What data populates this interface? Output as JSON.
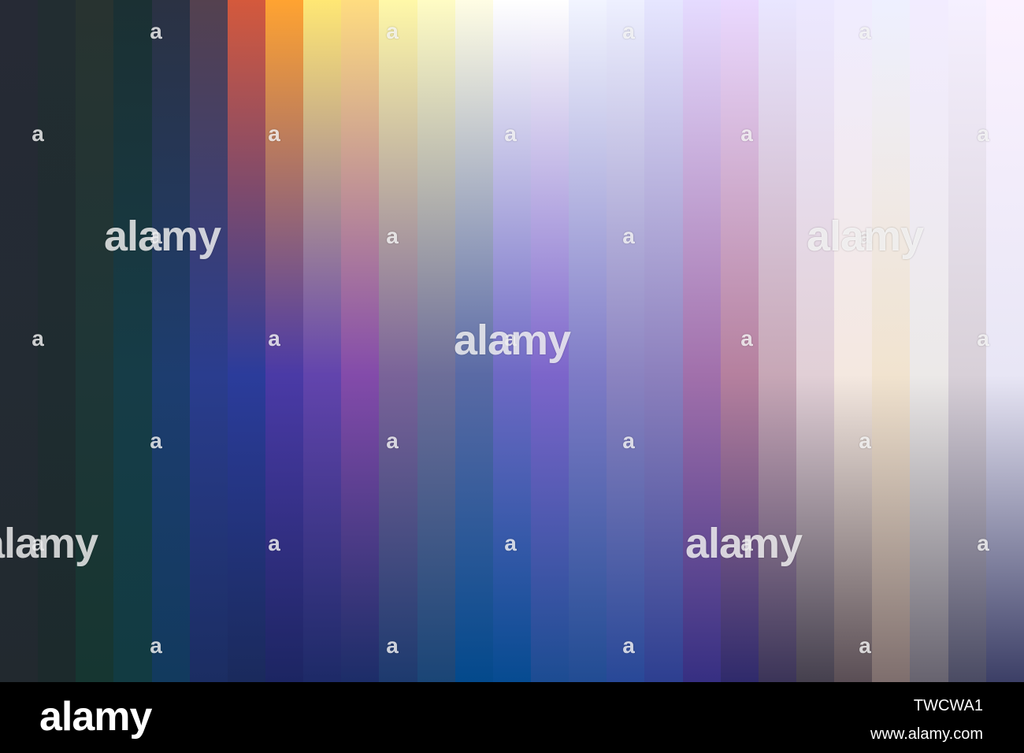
{
  "stripes": [
    [
      "#262a35",
      "#232b33",
      "#22292f"
    ],
    [
      "#222d31",
      "#1f2c30",
      "#1c2a2c"
    ],
    [
      "#283330",
      "#1e3637",
      "#163631"
    ],
    [
      "#1b3033",
      "#163c47",
      "#123b42"
    ],
    [
      "#2b3243",
      "#1d3d6f",
      "#123a5e"
    ],
    [
      "#54414f",
      "#2a3d8e",
      "#1b2d62"
    ],
    [
      "#d4593c",
      "#2b3c9b",
      "#1a2a5c"
    ],
    [
      "#ffa331",
      "#4a3aa6",
      "#1c2562"
    ],
    [
      "#ffe774",
      "#6244ad",
      "#1d2a67"
    ],
    [
      "#ffdc80",
      "#834baa",
      "#1c2d68"
    ],
    [
      "#fff8a8",
      "#7a6399",
      "#1d3a6e"
    ],
    [
      "#fffcc4",
      "#6d6e99",
      "#1a4576"
    ],
    [
      "#fffde4",
      "#5a6aa5",
      "#03498c"
    ],
    [
      "#ffffff",
      "#6e69c4",
      "#064b91"
    ],
    [
      "#ffffff",
      "#7c65ca",
      "#1c4c92"
    ],
    [
      "#f2f5ff",
      "#7e7bc6",
      "#214c93"
    ],
    [
      "#eef0ff",
      "#8b83c0",
      "#284897"
    ],
    [
      "#e6e6ff",
      "#8c80bd",
      "#2d3f90"
    ],
    [
      "#e5dbff",
      "#a170ab",
      "#362f82"
    ],
    [
      "#ead9ff",
      "#b5809e",
      "#2f2a6b"
    ],
    [
      "#e9e6ff",
      "#c7a7b6",
      "#3b3458"
    ],
    [
      "#ece8ff",
      "#e1cfd6",
      "#45404e"
    ],
    [
      "#f0ecff",
      "#f4e8e0",
      "#5a4e55"
    ],
    [
      "#eef0ff",
      "#f1e3cf",
      "#7e6e6d"
    ],
    [
      "#f2ecff",
      "#ece9e8",
      "#67636f"
    ],
    [
      "#f5f0ff",
      "#d8d0d8",
      "#4a4b63"
    ],
    [
      "#fbf2ff",
      "#e8e6f5",
      "#3c3f66"
    ]
  ],
  "watermark": {
    "small_text": "a",
    "big_text": "alamy"
  },
  "footer": {
    "brand": "alamy",
    "image_id": "TWCWA1",
    "site": "www.alamy.com"
  }
}
